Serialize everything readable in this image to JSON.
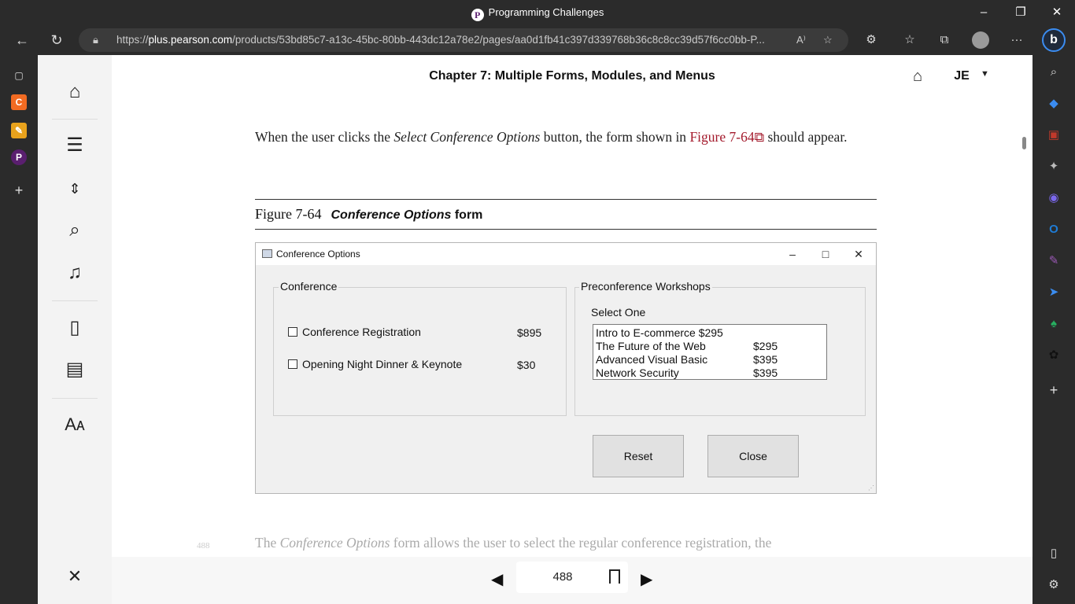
{
  "window": {
    "title": "Programming Challenges",
    "logo_letter": "P",
    "minimize": "–",
    "restore": "❐",
    "close": "✕"
  },
  "browser": {
    "url_prefix": "https://",
    "url_host": "plus.pearson.com",
    "url_path": "/products/53bd85c7-a13c-45bc-80bb-443dc12a78e2/pages/aa0d1fb41c397d339768b36c8c8cc39d57f6cc0bb-P...",
    "read_aloud": "A⁾",
    "more": "···",
    "bing_label": "b"
  },
  "edge_left": {
    "items": [
      "▢",
      "C",
      "✎",
      "P",
      "+"
    ]
  },
  "edge_right": {
    "items": [
      "⌕",
      "◆",
      "▣",
      "✦",
      "◉",
      "O",
      "✎",
      "➤",
      "♠",
      "✿",
      "+"
    ]
  },
  "header": {
    "chapter_title": "Chapter 7: Multiple Forms, Modules, and Menus",
    "user_initials": "JE"
  },
  "body": {
    "para_part1": "When the user clicks the ",
    "para_italic": "Select Conference Options",
    "para_part2": " button, the form shown in ",
    "para_link": "Figure 7-64",
    "para_part3": " should appear.",
    "figure_label": "Figure 7-64",
    "figure_caption_italic": "Conference Options",
    "figure_caption_rest": " form",
    "faded_text_part1": "The ",
    "faded_text_italic": "Conference Options",
    "faded_text_part2": " form allows the user to select the regular conference registration, the",
    "side_page_number": "488"
  },
  "dialog": {
    "title": "Conference Options",
    "conference_group": "Conference",
    "items": [
      {
        "label": "Conference Registration",
        "price": "$895"
      },
      {
        "label": "Opening Night Dinner & Keynote",
        "price": "$30"
      }
    ],
    "workshops_group": "Preconference Workshops",
    "select_one": "Select One",
    "workshops": [
      {
        "name": "Intro to E-commerce $295",
        "price": ""
      },
      {
        "name": "The Future of the Web",
        "price": "$295"
      },
      {
        "name": "Advanced Visual Basic",
        "price": "$395"
      },
      {
        "name": "Network Security",
        "price": "$395"
      }
    ],
    "reset_label": "Reset",
    "close_label": "Close"
  },
  "pager": {
    "page_number": "488"
  }
}
